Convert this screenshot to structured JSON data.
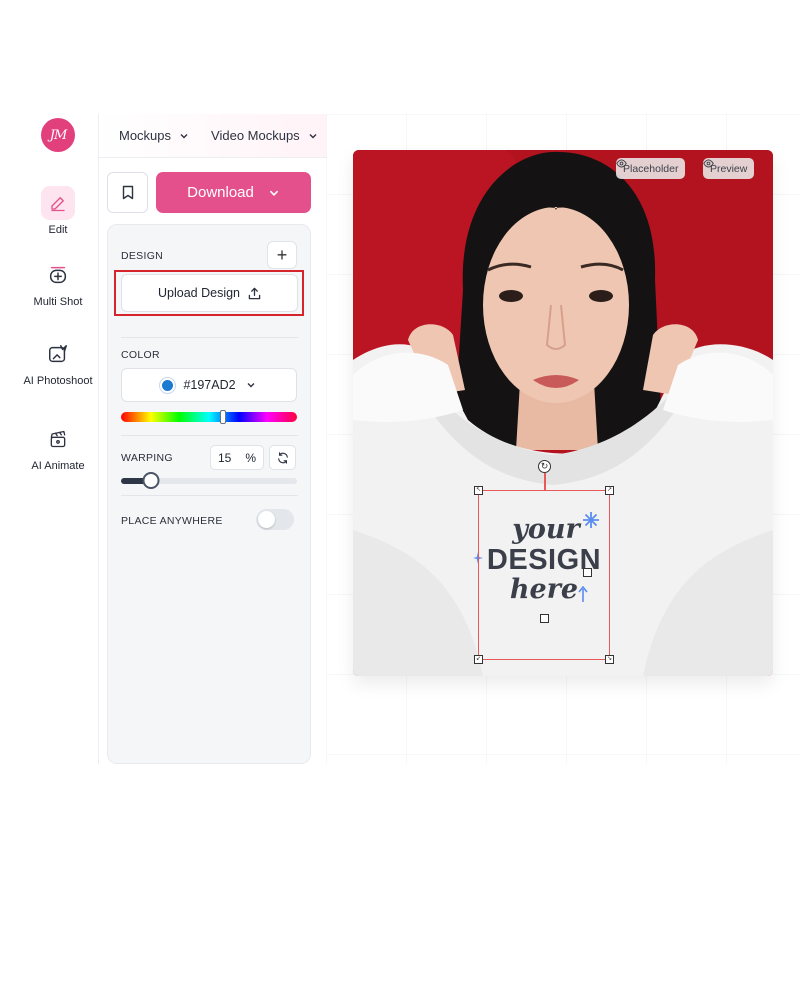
{
  "sidebar": {
    "logo_text": "JM",
    "items": [
      {
        "label": "Edit",
        "icon": "pencil-icon",
        "active": true
      },
      {
        "label": "Multi Shot",
        "icon": "multi-shot-icon",
        "active": false
      },
      {
        "label": "AI Photoshoot",
        "icon": "ai-photoshoot-icon",
        "active": false
      },
      {
        "label": "AI Animate",
        "icon": "clapperboard-icon",
        "active": false
      }
    ]
  },
  "topnav": {
    "items": [
      {
        "label": "Mockups",
        "icon": "chevron-down-icon"
      },
      {
        "label": "Video Mockups",
        "icon": "chevron-down-icon"
      }
    ]
  },
  "toolbar": {
    "bookmark_icon": "bookmark-icon",
    "download_label": "Download"
  },
  "design": {
    "section_label": "DESIGN",
    "add_icon": "plus-icon",
    "upload_label": "Upload Design",
    "upload_icon": "upload-icon"
  },
  "color": {
    "section_label": "COLOR",
    "value": "#197AD2",
    "hue_position": 0.58
  },
  "warping": {
    "section_label": "WARPING",
    "value": "15",
    "unit": "%",
    "slider_fraction": 0.17,
    "reset_icon": "refresh-icon"
  },
  "place_anywhere": {
    "label": "PLACE ANYWHERE",
    "enabled": false
  },
  "canvas": {
    "placeholder_label": "Placeholder",
    "preview_label": "Preview",
    "design_text": {
      "line1": "your",
      "line2": "DESIGN",
      "line3": "here"
    },
    "colors": {
      "background": "#B3121F",
      "hoodie": "#F2F2F2",
      "box": "#E85A5A",
      "sparkle": "#5B8DEF"
    }
  }
}
